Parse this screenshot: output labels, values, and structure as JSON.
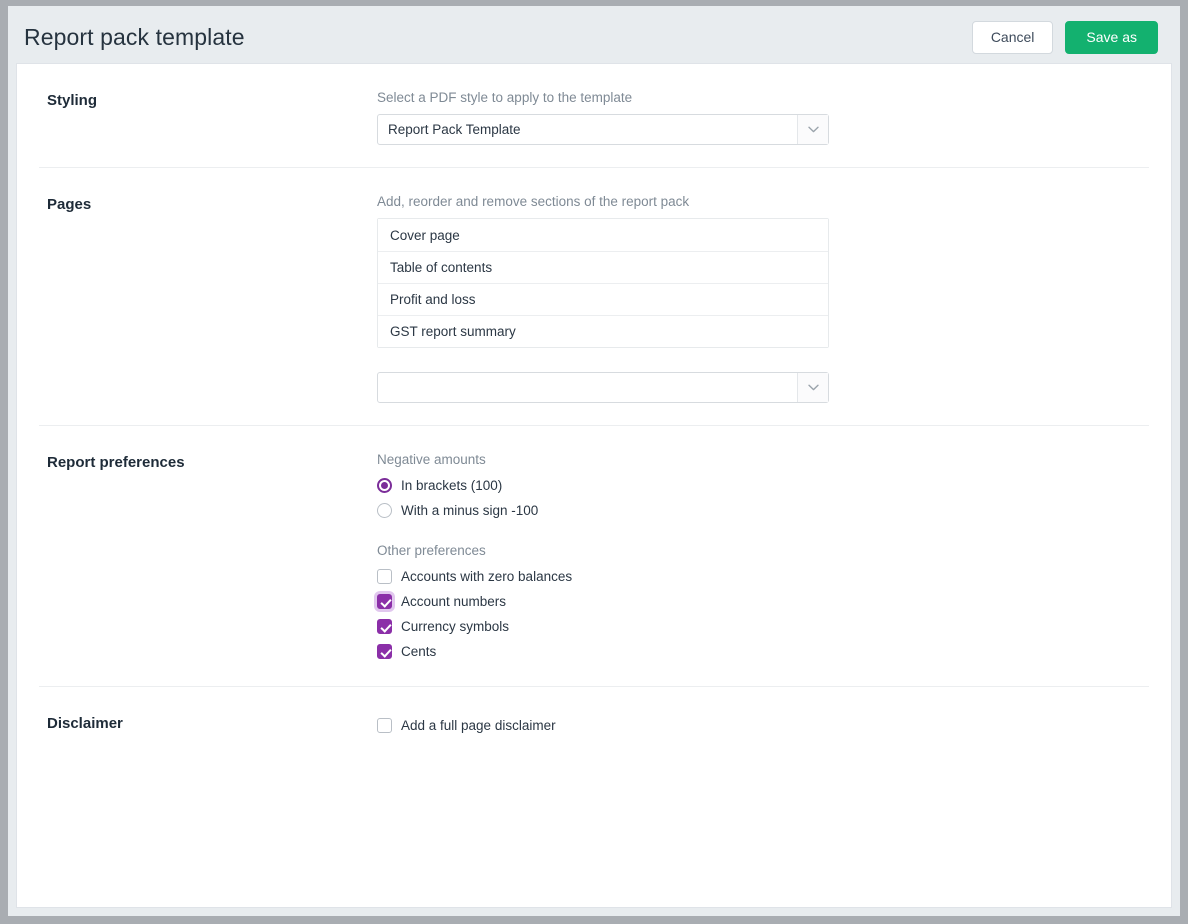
{
  "header": {
    "title": "Report pack template",
    "cancel_label": "Cancel",
    "save_label": "Save as"
  },
  "styling": {
    "section_title": "Styling",
    "field_label": "Select a PDF style to apply to the template",
    "selected_style": "Report Pack Template"
  },
  "pages": {
    "section_title": "Pages",
    "field_label": "Add, reorder and remove sections of the report pack",
    "rows": [
      {
        "label": "Cover page"
      },
      {
        "label": "Table of contents"
      },
      {
        "label": "Profit and loss"
      },
      {
        "label": "GST report summary"
      }
    ],
    "add_select_value": ""
  },
  "report_preferences": {
    "section_title": "Report preferences",
    "negative_amounts": {
      "heading": "Negative amounts",
      "options": [
        {
          "label": "In brackets (100)",
          "checked": true
        },
        {
          "label": "With a minus sign -100",
          "checked": false
        }
      ]
    },
    "other_preferences": {
      "heading": "Other preferences",
      "options": [
        {
          "label": "Accounts with zero balances",
          "checked": false,
          "focused": false
        },
        {
          "label": "Account numbers",
          "checked": true,
          "focused": true
        },
        {
          "label": "Currency symbols",
          "checked": true,
          "focused": false
        },
        {
          "label": "Cents",
          "checked": true,
          "focused": false
        }
      ]
    }
  },
  "disclaimer": {
    "section_title": "Disclaimer",
    "option": {
      "label": "Add a full page disclaimer",
      "checked": false
    }
  },
  "colors": {
    "accent_purple": "#8b2fa8",
    "save_green": "#13b16f",
    "header_bg": "#e8ecef",
    "text_primary": "#2b3744",
    "text_muted": "#7f8a95"
  }
}
